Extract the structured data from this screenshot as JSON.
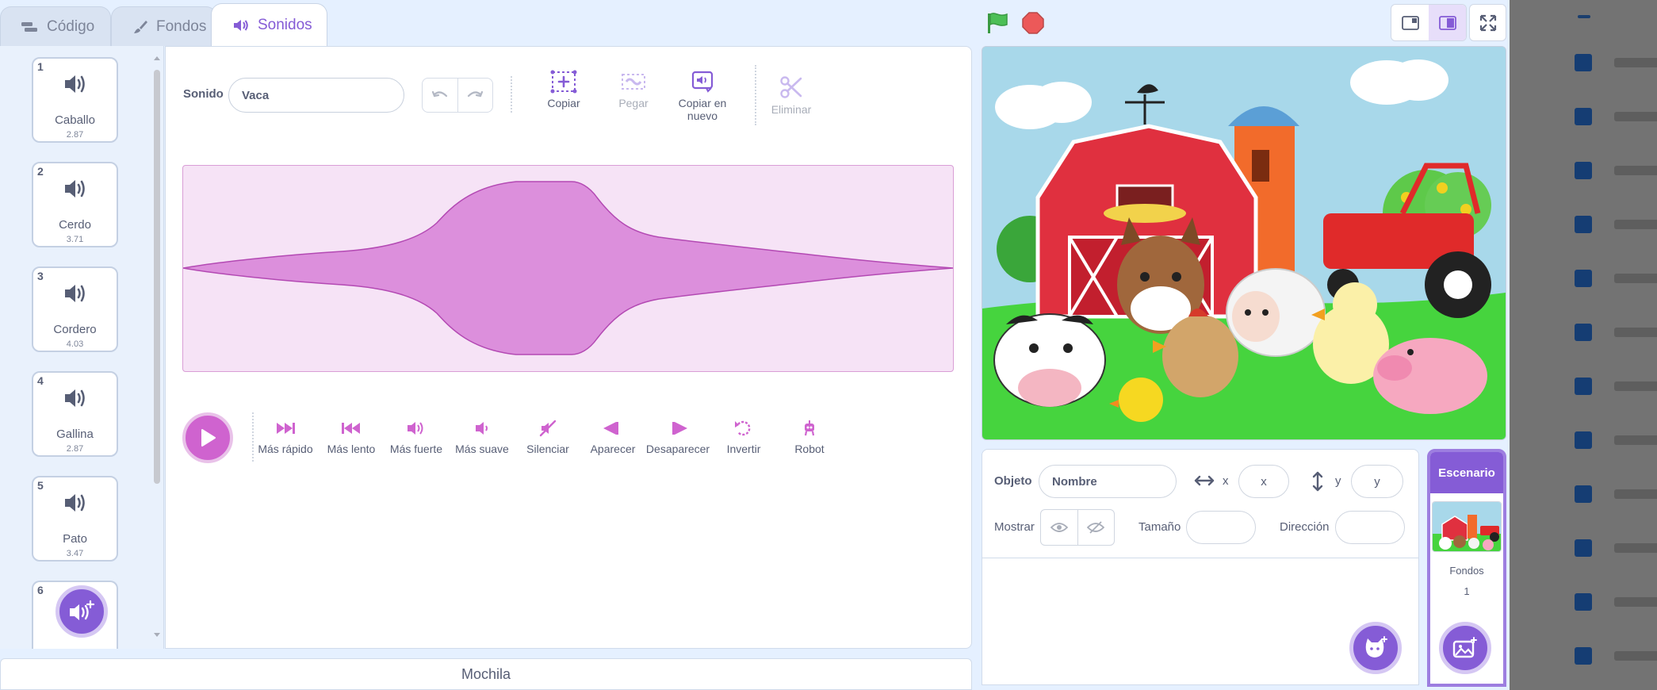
{
  "tabs": [
    {
      "label": "Código"
    },
    {
      "label": "Fondos"
    },
    {
      "label": "Sonidos"
    }
  ],
  "sounds": [
    {
      "num": "1",
      "name": "Caballo",
      "duration": "2.87"
    },
    {
      "num": "2",
      "name": "Cerdo",
      "duration": "3.71"
    },
    {
      "num": "3",
      "name": "Cordero",
      "duration": "4.03"
    },
    {
      "num": "4",
      "name": "Gallina",
      "duration": "2.87"
    },
    {
      "num": "5",
      "name": "Pato",
      "duration": "3.47"
    },
    {
      "num": "6",
      "name": "",
      "duration": ""
    }
  ],
  "editor": {
    "sound_label": "Sonido",
    "sound_name": "Vaca",
    "tools": {
      "copy": "Copiar",
      "paste": "Pegar",
      "copy_new": "Copiar en nuevo",
      "delete": "Eliminar"
    },
    "effects": {
      "faster": "Más rápido",
      "slower": "Más lento",
      "louder": "Más fuerte",
      "softer": "Más suave",
      "mute": "Silenciar",
      "fade_in": "Aparecer",
      "fade_out": "Desaparecer",
      "reverse": "Invertir",
      "robot": "Robot"
    }
  },
  "backpack": {
    "label": "Mochila"
  },
  "sprite_info": {
    "sprite_label": "Objeto",
    "name_placeholder": "Nombre",
    "x_label": "x",
    "x_placeholder": "x",
    "y_label": "y",
    "y_placeholder": "y",
    "show_label": "Mostrar",
    "size_label": "Tamaño",
    "direction_label": "Dirección"
  },
  "stage_selector": {
    "title": "Escenario",
    "backdrops_label": "Fondos",
    "backdrops_count": "1"
  },
  "colors": {
    "accent": "#855cd6",
    "sound_pink": "#cf63cf",
    "flag_green": "#4cbf56",
    "stop_red": "#ec5959"
  }
}
